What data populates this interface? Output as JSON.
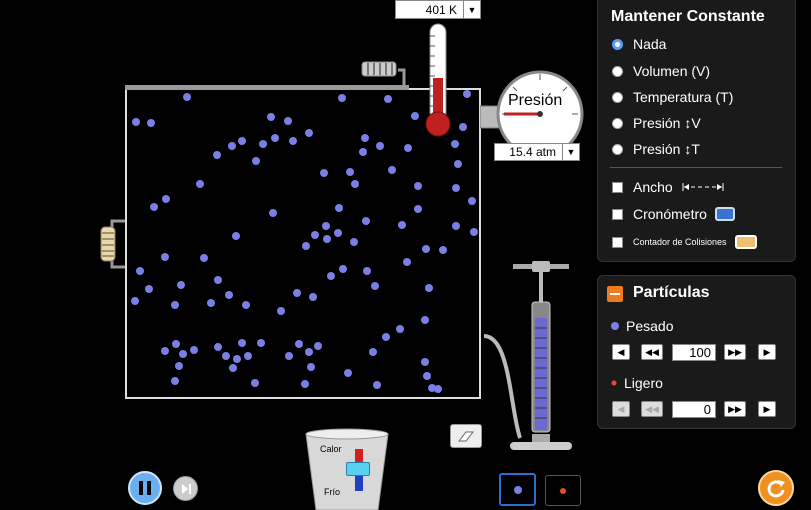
{
  "thermometer": {
    "value": "401 K",
    "dropdown_icon": "triangle-down"
  },
  "gauge": {
    "title": "Presión",
    "value": "15.4 atm",
    "dropdown_icon": "triangle-down"
  },
  "constant_panel": {
    "title": "Mantener Constante",
    "options": [
      "Nada",
      "Volumen (V)",
      "Temperatura (T)",
      "Presión ↕V",
      "Presión ↕T"
    ],
    "selected": "Nada"
  },
  "tools": {
    "width_label": "Ancho",
    "stopwatch_label": "Cronómetro",
    "collision_label": "Contador de Colisiones"
  },
  "particles_panel": {
    "title": "Partículas",
    "collapse_icon": "minus",
    "heavy": {
      "label": "Pesado",
      "count": "100",
      "color": "#7a7fe6"
    },
    "light": {
      "label": "Ligero",
      "count": "0",
      "color": "#e05030"
    }
  },
  "heat_bucket": {
    "heat_label": "Calor",
    "cold_label": "Frío"
  },
  "controls": {
    "play_pause_icon": "pause",
    "step_icon": "step-forward",
    "reset_icon": "reset",
    "eraser_icon": "eraser"
  },
  "species_selector": {
    "heavy_icon": "heavy-particle",
    "light_icon": "light-particle"
  },
  "colors": {
    "accent": "#e8821e",
    "heavy_particle": "#7a7fe6",
    "light_particle": "#e05030",
    "selected_border": "#2a6fd0"
  }
}
